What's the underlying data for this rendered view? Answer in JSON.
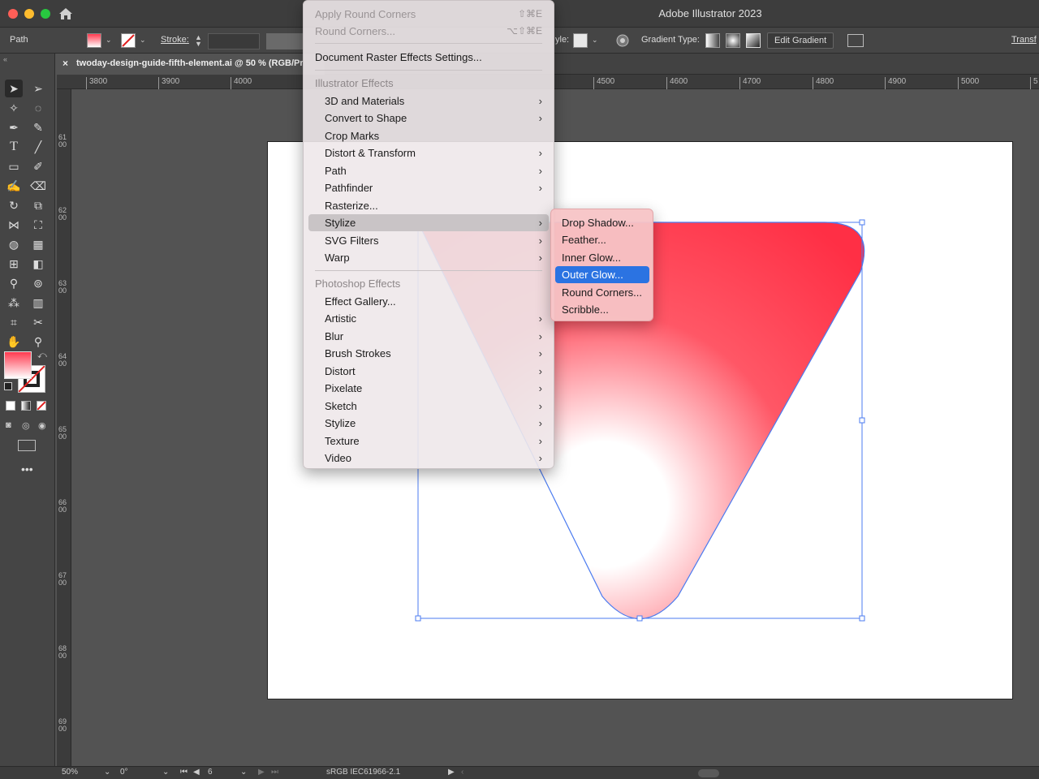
{
  "window": {
    "title": "Adobe Illustrator 2023"
  },
  "control_bar": {
    "selection_type": "Path",
    "stroke_label": "Stroke:",
    "style_label": "yle:",
    "gradient_type_label": "Gradient Type:",
    "edit_gradient_button": "Edit Gradient",
    "transform_label": "Transf"
  },
  "document_tab": {
    "label": "twoday-design-guide-fifth-element.ai @ 50 % (RGB/Pr",
    "close": "×"
  },
  "ruler": {
    "horizontal": [
      "3800",
      "3900",
      "4000",
      "4500",
      "4600",
      "4700",
      "4800",
      "4900",
      "5000",
      "5"
    ],
    "vertical": [
      "6100",
      "6200",
      "6300",
      "6400",
      "6500",
      "6600",
      "6700",
      "6800",
      "6900"
    ]
  },
  "effect_menu": {
    "top_items": [
      {
        "label": "Apply Round Corners",
        "shortcut": "⇧⌘E",
        "disabled": true
      },
      {
        "label": "Round Corners...",
        "shortcut": "⌥⇧⌘E",
        "disabled": true
      }
    ],
    "document_raster": "Document Raster Effects Settings...",
    "illustrator_header": "Illustrator Effects",
    "illustrator_items": [
      {
        "label": "3D and Materials",
        "submenu": true
      },
      {
        "label": "Convert to Shape",
        "submenu": true
      },
      {
        "label": "Crop Marks",
        "submenu": false
      },
      {
        "label": "Distort & Transform",
        "submenu": true
      },
      {
        "label": "Path",
        "submenu": true
      },
      {
        "label": "Pathfinder",
        "submenu": true
      },
      {
        "label": "Rasterize...",
        "submenu": false
      },
      {
        "label": "Stylize",
        "submenu": true,
        "highlighted": true
      },
      {
        "label": "SVG Filters",
        "submenu": true
      },
      {
        "label": "Warp",
        "submenu": true
      }
    ],
    "photoshop_header": "Photoshop Effects",
    "photoshop_items": [
      {
        "label": "Effect Gallery...",
        "submenu": false
      },
      {
        "label": "Artistic",
        "submenu": true
      },
      {
        "label": "Blur",
        "submenu": true
      },
      {
        "label": "Brush Strokes",
        "submenu": true
      },
      {
        "label": "Distort",
        "submenu": true
      },
      {
        "label": "Pixelate",
        "submenu": true
      },
      {
        "label": "Sketch",
        "submenu": true
      },
      {
        "label": "Stylize",
        "submenu": true
      },
      {
        "label": "Texture",
        "submenu": true
      },
      {
        "label": "Video",
        "submenu": true
      }
    ],
    "chevron": "›"
  },
  "stylize_submenu": {
    "items": [
      {
        "label": "Drop Shadow..."
      },
      {
        "label": "Feather..."
      },
      {
        "label": "Inner Glow..."
      },
      {
        "label": "Outer Glow...",
        "highlighted": true
      },
      {
        "label": "Round Corners..."
      },
      {
        "label": "Scribble..."
      }
    ]
  },
  "status_bar": {
    "zoom": "50%",
    "rotation": "0°",
    "artboard": "6",
    "color_profile": "sRGB IEC61966-2.1"
  },
  "colors": {
    "gradient_red": "#ff2f45",
    "selection_blue": "#4b7bf0",
    "menu_highlight": "#2b73e2"
  },
  "icons": {
    "home": "home-icon",
    "selection": "selection-tool-icon",
    "direct_selection": "direct-selection-tool-icon",
    "pen": "pen-tool-icon",
    "type": "type-tool-icon"
  }
}
